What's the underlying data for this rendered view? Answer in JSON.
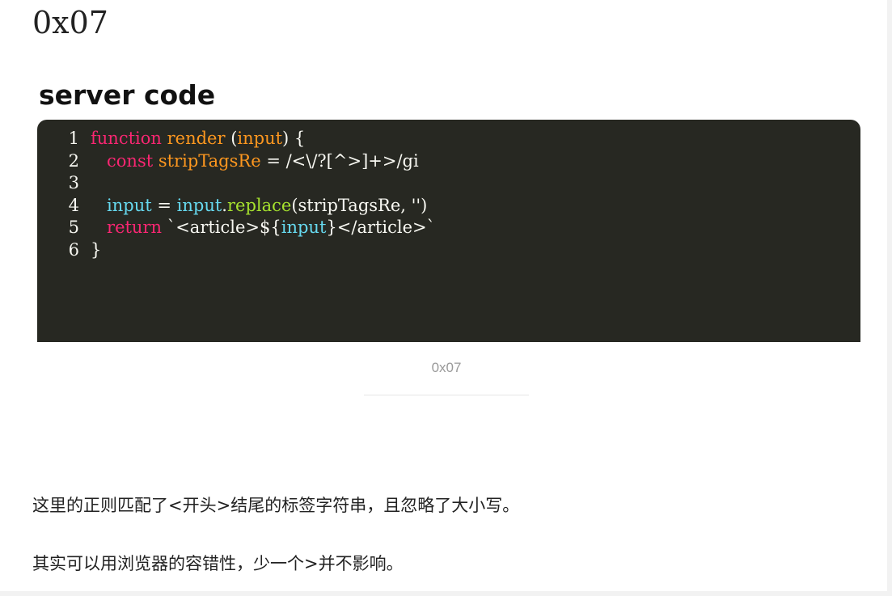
{
  "heading": "0x07",
  "figure": {
    "title": "server code",
    "caption": "0x07",
    "code_lines": [
      {
        "num": "1",
        "tokens": [
          {
            "t": "function",
            "c": "kw"
          },
          {
            "t": " ",
            "c": "pl"
          },
          {
            "t": "render",
            "c": "fn"
          },
          {
            "t": " (",
            "c": "pl"
          },
          {
            "t": "input",
            "c": "var"
          },
          {
            "t": ") {",
            "c": "pl"
          }
        ]
      },
      {
        "num": "2",
        "tokens": [
          {
            "t": "   ",
            "c": "pl"
          },
          {
            "t": "const",
            "c": "kw"
          },
          {
            "t": " ",
            "c": "pl"
          },
          {
            "t": "stripTagsRe",
            "c": "var"
          },
          {
            "t": " = /<\\/?[^>]+>/gi",
            "c": "pl"
          }
        ]
      },
      {
        "num": "3",
        "tokens": []
      },
      {
        "num": "4",
        "tokens": [
          {
            "t": "   ",
            "c": "pl"
          },
          {
            "t": "input",
            "c": "id"
          },
          {
            "t": " = ",
            "c": "pl"
          },
          {
            "t": "input",
            "c": "id"
          },
          {
            "t": ".",
            "c": "pl"
          },
          {
            "t": "replace",
            "c": "mt"
          },
          {
            "t": "(stripTagsRe, '')",
            "c": "pl"
          }
        ]
      },
      {
        "num": "5",
        "tokens": [
          {
            "t": "   ",
            "c": "pl"
          },
          {
            "t": "return",
            "c": "kw"
          },
          {
            "t": " `<article>${",
            "c": "pl"
          },
          {
            "t": "input",
            "c": "id"
          },
          {
            "t": "}</article>`",
            "c": "pl"
          }
        ]
      },
      {
        "num": "6",
        "tokens": [
          {
            "t": "}",
            "c": "pl"
          }
        ]
      }
    ]
  },
  "paragraphs": [
    "这里的正则匹配了<开头>结尾的标签字符串，且忽略了大小写。",
    "其实可以用浏览器的容错性，少一个>并不影响。"
  ]
}
